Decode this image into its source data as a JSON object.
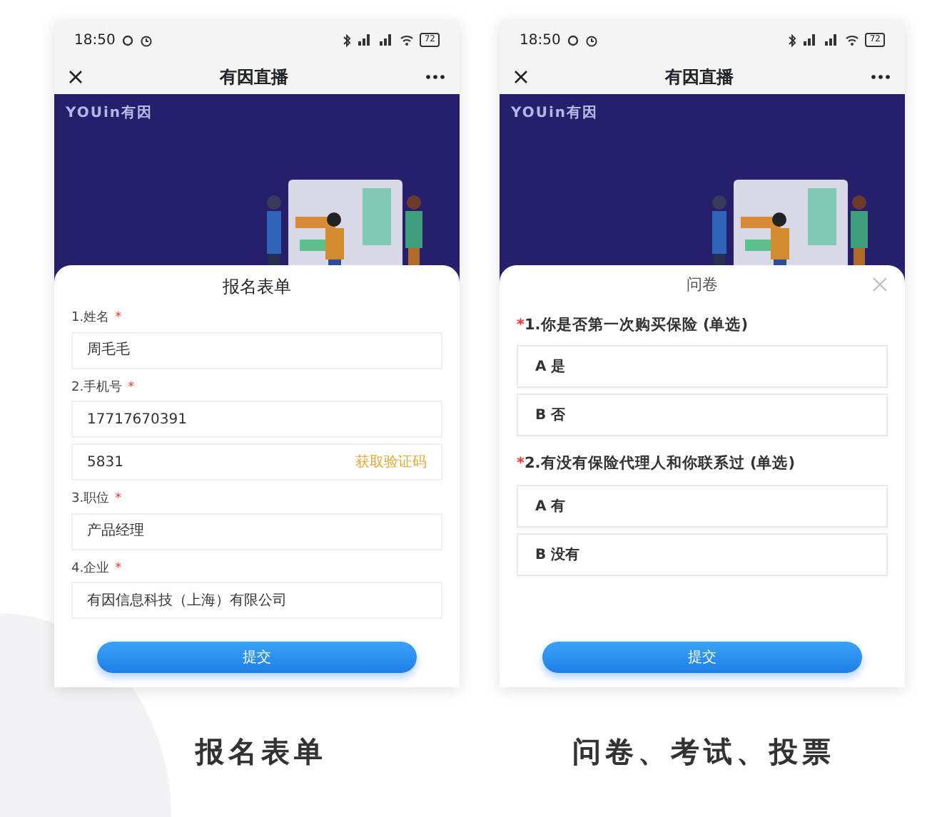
{
  "phones": [
    {
      "status_bar": {
        "time": "18:50",
        "battery": "72"
      },
      "title": "有因直播",
      "logo": "YOUin有因",
      "sheet": {
        "kind": "form",
        "title": "报名表单",
        "closable": false,
        "items": [
          {
            "kind": "field",
            "label": "1.姓名",
            "required_mark": "*",
            "value": "周毛毛"
          },
          {
            "kind": "field",
            "label": "2.手机号",
            "required_mark": "*",
            "value": "17717670391"
          },
          {
            "kind": "code",
            "value": "5831",
            "action": "获取验证码"
          },
          {
            "kind": "field",
            "label": "3.职位",
            "required_mark": "*",
            "value": "产品经理"
          },
          {
            "kind": "field",
            "label": "4.企业",
            "required_mark": "*",
            "value": "有因信息科技（上海）有限公司"
          }
        ],
        "submit": "提交"
      }
    },
    {
      "status_bar": {
        "time": "18:50",
        "battery": "72"
      },
      "title": "有因直播",
      "logo": "YOUin有因",
      "sheet": {
        "kind": "survey",
        "title": "问卷",
        "closable": true,
        "items": [
          {
            "kind": "question",
            "text": "1.你是否第一次购买保险 (单选)",
            "required_mark": "*",
            "options": [
              {
                "letter": "A",
                "text": "是",
                "selected": false
              },
              {
                "letter": "B",
                "text": "否",
                "selected": false
              }
            ]
          },
          {
            "kind": "question",
            "text": "2.有没有保险代理人和你联系过 (单选)",
            "required_mark": "*",
            "options": [
              {
                "letter": "A",
                "text": "有",
                "selected": false
              },
              {
                "letter": "B",
                "text": "没有",
                "selected": false
              }
            ]
          }
        ],
        "submit": "提交"
      }
    }
  ],
  "captions": [
    "报名表单",
    "问卷、考试、投票"
  ]
}
